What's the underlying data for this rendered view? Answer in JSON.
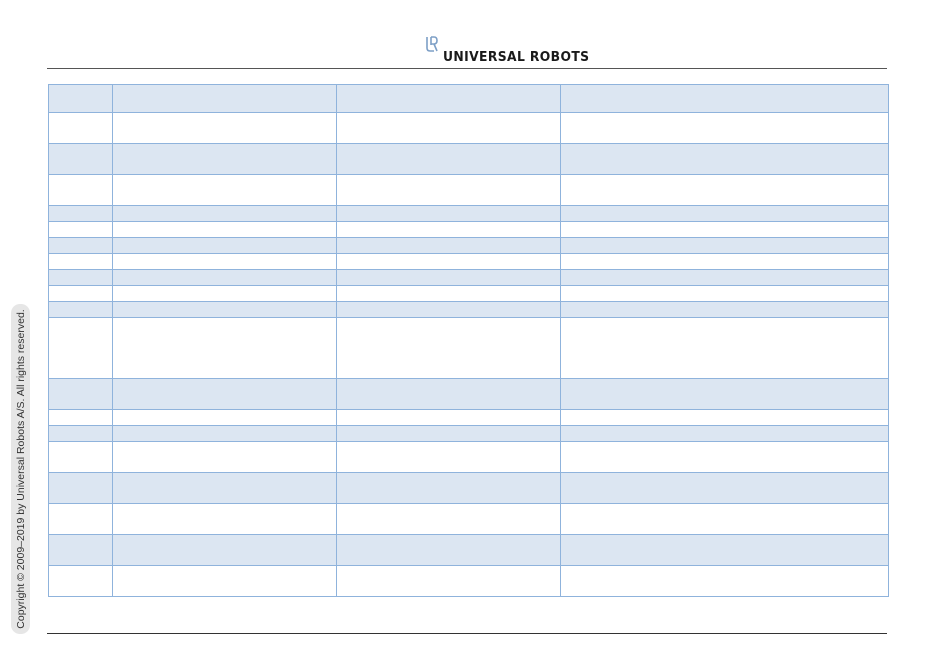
{
  "header": {
    "brand": "UNIVERSAL ROBOTS",
    "logo_icon": "ur-logo-icon"
  },
  "sidebar": {
    "copyright": "Copyright © 2009–2019 by Universal Robots A/S. All rights reserved."
  },
  "table": {
    "columns": 4,
    "rows": [
      {
        "shade": "shaded",
        "cells": [
          "",
          "",
          "",
          ""
        ]
      },
      {
        "shade": "plain",
        "cells": [
          "",
          "",
          "",
          ""
        ]
      },
      {
        "shade": "shaded",
        "cells": [
          "",
          "",
          "",
          ""
        ]
      },
      {
        "shade": "plain",
        "cells": [
          "",
          "",
          "",
          ""
        ]
      },
      {
        "shade": "shaded",
        "cells": [
          "",
          "",
          "",
          ""
        ]
      },
      {
        "shade": "plain",
        "cells": [
          "",
          "",
          "",
          ""
        ]
      },
      {
        "shade": "shaded",
        "cells": [
          "",
          "",
          "",
          ""
        ]
      },
      {
        "shade": "plain",
        "cells": [
          "",
          "",
          "",
          ""
        ]
      },
      {
        "shade": "shaded",
        "cells": [
          "",
          "",
          "",
          ""
        ]
      },
      {
        "shade": "plain",
        "cells": [
          "",
          "",
          "",
          ""
        ]
      },
      {
        "shade": "shaded",
        "cells": [
          "",
          "",
          "",
          ""
        ]
      },
      {
        "shade": "plain",
        "cells": [
          "",
          "",
          "",
          ""
        ]
      },
      {
        "shade": "shaded",
        "cells": [
          "",
          "",
          "",
          ""
        ]
      },
      {
        "shade": "plain",
        "cells": [
          "",
          "",
          "",
          ""
        ]
      },
      {
        "shade": "shaded",
        "cells": [
          "",
          "",
          "",
          ""
        ]
      },
      {
        "shade": "plain",
        "cells": [
          "",
          "",
          "",
          ""
        ]
      },
      {
        "shade": "shaded",
        "cells": [
          "",
          "",
          "",
          ""
        ]
      },
      {
        "shade": "plain",
        "cells": [
          "",
          "",
          "",
          ""
        ]
      },
      {
        "shade": "shaded",
        "cells": [
          "",
          "",
          "",
          ""
        ]
      },
      {
        "shade": "plain",
        "cells": [
          "",
          "",
          "",
          ""
        ]
      }
    ]
  }
}
